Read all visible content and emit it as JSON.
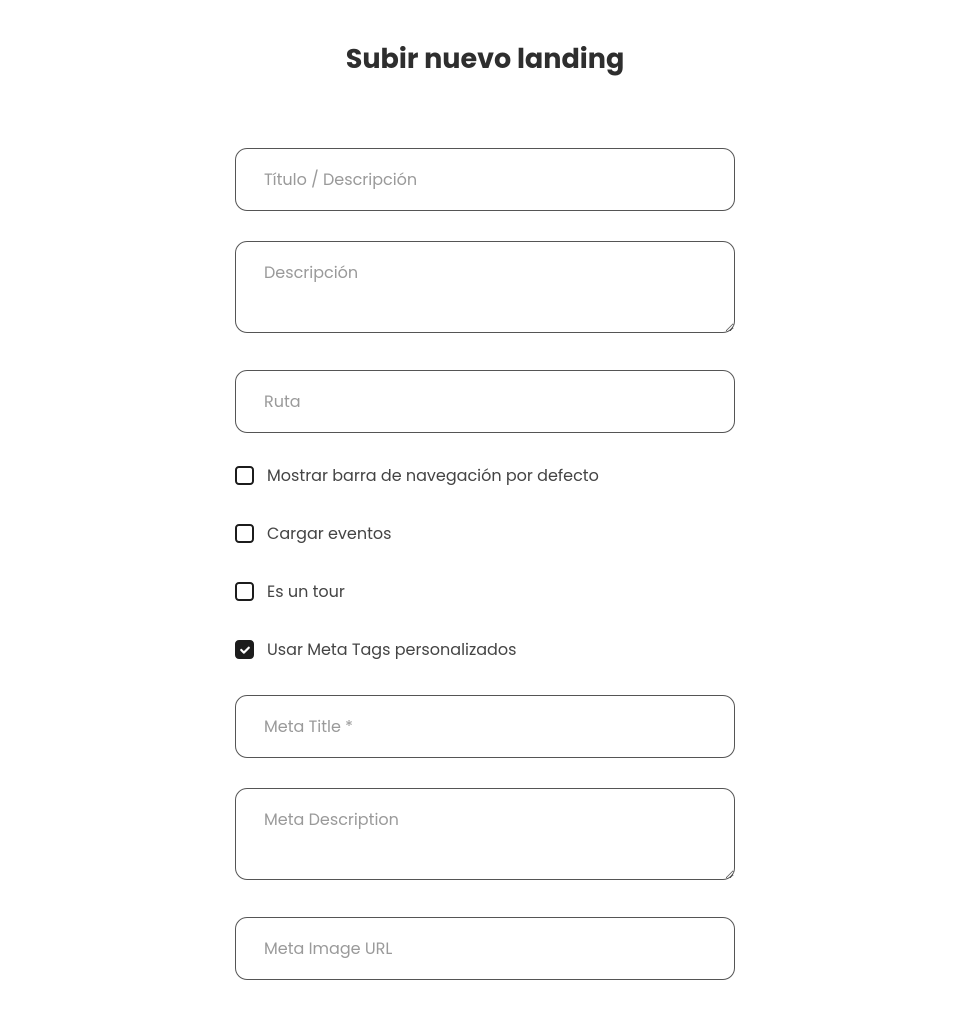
{
  "page_title": "Subir nuevo landing",
  "fields": {
    "title_placeholder": "Título / Descripción",
    "title_value": "",
    "description_placeholder": "Descripción",
    "description_value": "",
    "route_placeholder": "Ruta",
    "route_value": "",
    "meta_title_placeholder": "Meta Title *",
    "meta_title_value": "",
    "meta_description_placeholder": "Meta Description",
    "meta_description_value": "",
    "meta_image_placeholder": "Meta Image URL",
    "meta_image_value": ""
  },
  "checkboxes": {
    "show_navbar": {
      "label": "Mostrar barra de navegación por defecto",
      "checked": false
    },
    "load_events": {
      "label": "Cargar eventos",
      "checked": false
    },
    "is_tour": {
      "label": "Es un tour",
      "checked": false
    },
    "use_meta_tags": {
      "label": "Usar Meta Tags personalizados",
      "checked": true
    }
  }
}
